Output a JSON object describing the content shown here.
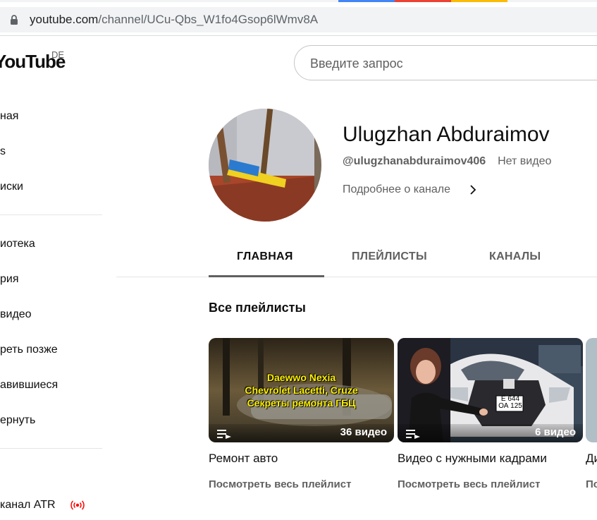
{
  "browser": {
    "url_host": "youtube.com",
    "url_path": "/channel/UCu-Qbs_W1fo4Gsop6lWmv8A"
  },
  "logo": {
    "text": "YouTube",
    "country": "DE"
  },
  "search": {
    "placeholder": "Введите запрос"
  },
  "sidebar": {
    "items": [
      {
        "label": "ная"
      },
      {
        "label": "s"
      },
      {
        "label": "иски"
      },
      {
        "label": "иотека"
      },
      {
        "label": "рия"
      },
      {
        "label": " видео"
      },
      {
        "label": "реть позже"
      },
      {
        "label": "авившиеся"
      },
      {
        "label": "ернуть"
      },
      {
        "label": "канал ATR"
      }
    ]
  },
  "channel": {
    "name": "Ulugzhan Abduraimov",
    "handle": "@ulugzhanabduraimov406",
    "video_status": "Нет видео",
    "more_label": "Подробнее о канале"
  },
  "tabs": [
    {
      "label": "ГЛАВНАЯ",
      "active": true
    },
    {
      "label": "ПЛЕЙЛИСТЫ",
      "active": false
    },
    {
      "label": "КАНАЛЫ",
      "active": false
    }
  ],
  "section": {
    "title": "Все плейлисты"
  },
  "playlists": [
    {
      "title": "Ремонт авто",
      "count": "36 видео",
      "link": "Посмотреть весь плейлист",
      "thumb_lines": [
        "Daewwo Nexia",
        "Chevrolet Lacetti, Cruze",
        "Секреты ремонта ГБЦ"
      ]
    },
    {
      "title": "Видео с нужными кадрами",
      "count": "6 видео",
      "link": "Посмотреть весь плейлист",
      "plate_top": "Е 644",
      "plate_bottom": "ОА 125"
    },
    {
      "title": "Ди",
      "link": "По"
    }
  ],
  "colors": {
    "accent": "#ff0000",
    "text": "#0f0f0f",
    "secondary": "#606060"
  }
}
